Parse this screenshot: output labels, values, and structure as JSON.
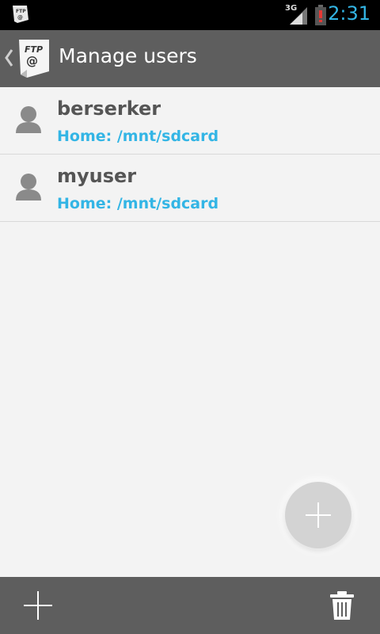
{
  "status_bar": {
    "network_label": "3G",
    "time": "2:31"
  },
  "action_bar": {
    "title": "Manage users",
    "logo_text_top": "FTP",
    "logo_text_bottom": "@"
  },
  "users": [
    {
      "name": "berserker",
      "home": "Home: /mnt/sdcard"
    },
    {
      "name": "myuser",
      "home": "Home: /mnt/sdcard"
    }
  ],
  "colors": {
    "accent": "#33b5e5",
    "bar": "#5e5e5e",
    "background": "#f3f3f3"
  },
  "icons": {
    "fab": "plus-icon",
    "bottom_left": "plus-icon",
    "bottom_right": "trash-icon",
    "avatar": "person-icon"
  }
}
